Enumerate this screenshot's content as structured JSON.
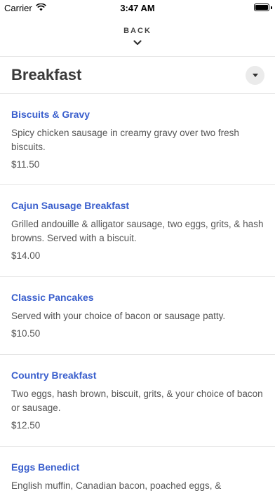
{
  "status_bar": {
    "carrier": "Carrier",
    "time": "3:47 AM"
  },
  "nav": {
    "back_label": "BACK"
  },
  "section": {
    "title": "Breakfast"
  },
  "menu_items": [
    {
      "name": "Biscuits & Gravy",
      "description": "Spicy chicken sausage in creamy gravy over two fresh biscuits.",
      "price": "$11.50"
    },
    {
      "name": "Cajun Sausage Breakfast",
      "description": "Grilled andouille & alligator sausage, two eggs, grits, & hash browns. Served with a biscuit.",
      "price": "$14.00"
    },
    {
      "name": "Classic Pancakes",
      "description": "Served with your choice of bacon or sausage patty.",
      "price": "$10.50"
    },
    {
      "name": "Country Breakfast",
      "description": "Two eggs, hash brown, biscuit, grits, & your choice of bacon or sausage.",
      "price": "$12.50"
    },
    {
      "name": "Eggs Benedict",
      "description": "English muffin, Canadian bacon, poached eggs, &",
      "price": ""
    }
  ],
  "colors": {
    "item_name": "#3a5fcd",
    "divider": "#e6e6e6"
  }
}
